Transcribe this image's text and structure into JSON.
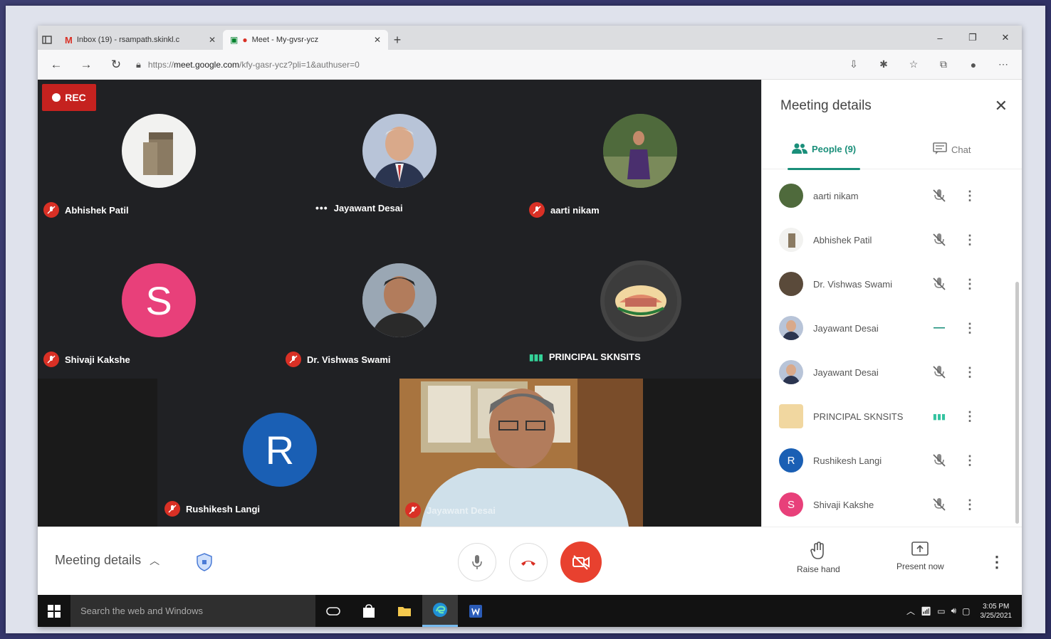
{
  "browser": {
    "tabs": [
      {
        "label": "Inbox (19) - rsampath.skinkl.c",
        "active": false
      },
      {
        "label": "Meet - My-gvsr-ycz",
        "active": true
      }
    ],
    "url": {
      "prefix": "https://",
      "host": "meet.google.com",
      "path": "/kfy-gasr-ycz?pli=1&authuser=0"
    }
  },
  "recording": {
    "label": "REC"
  },
  "participants_tiles": [
    {
      "name": "Abhishek Patil",
      "status": "muted"
    },
    {
      "name": "Jayawant Desai",
      "status": "connecting"
    },
    {
      "name": "aarti nikam",
      "status": "muted"
    },
    {
      "name": "Shivaji Kakshe",
      "status": "muted",
      "initial": "S",
      "color": "#e8407a"
    },
    {
      "name": "Dr. Vishwas Swami",
      "status": "muted"
    },
    {
      "name": "PRINCIPAL SKNSITS",
      "status": "speaking"
    },
    {
      "name": "Rushikesh Langi",
      "status": "muted",
      "initial": "R",
      "color": "#1a5fb4"
    },
    {
      "name": "Jayawant Desai",
      "status": "muted"
    }
  ],
  "side_panel": {
    "title": "Meeting details",
    "tabs": {
      "people": "People (9)",
      "chat": "Chat"
    },
    "people": [
      {
        "name": "aarti nikam",
        "status": "muted"
      },
      {
        "name": "Abhishek Patil",
        "status": "muted"
      },
      {
        "name": "Dr. Vishwas Swami",
        "status": "muted"
      },
      {
        "name": "Jayawant Desai",
        "status": "connecting"
      },
      {
        "name": "Jayawant Desai",
        "status": "muted"
      },
      {
        "name": "PRINCIPAL SKNSITS",
        "status": "speaking"
      },
      {
        "name": "Rushikesh Langi",
        "status": "muted",
        "initial": "R",
        "color": "#1a5fb4"
      },
      {
        "name": "Shivaji Kakshe",
        "status": "muted",
        "initial": "S",
        "color": "#e8407a"
      }
    ]
  },
  "bottom_bar": {
    "meeting_details": "Meeting details",
    "raise_hand": "Raise hand",
    "present_now": "Present now"
  },
  "taskbar": {
    "search_placeholder": "Search the web and Windows",
    "time": "3:05 PM",
    "date": "3/25/2021"
  },
  "colors": {
    "meet_bg": "#202124",
    "rec": "#c5221f",
    "accent": "#1a8f7a",
    "camera_off": "#e8412f"
  }
}
